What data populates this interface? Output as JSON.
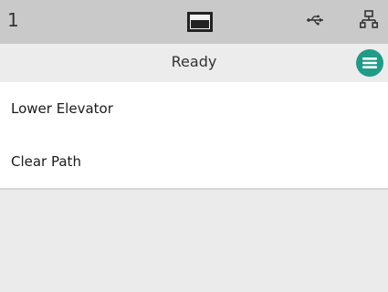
{
  "status_bar": {
    "number": "1",
    "icons": [
      "printer-icon",
      "usb-icon",
      "network-icon"
    ]
  },
  "header": {
    "title": "Ready",
    "menu_icon": "menu-icon"
  },
  "menu": {
    "items": [
      {
        "label": "Lower Elevator"
      },
      {
        "label": "Clear Path"
      }
    ]
  },
  "colors": {
    "status_bar_bg": "#c9c9c9",
    "header_bg": "#ececec",
    "accent": "#1f9b87"
  }
}
